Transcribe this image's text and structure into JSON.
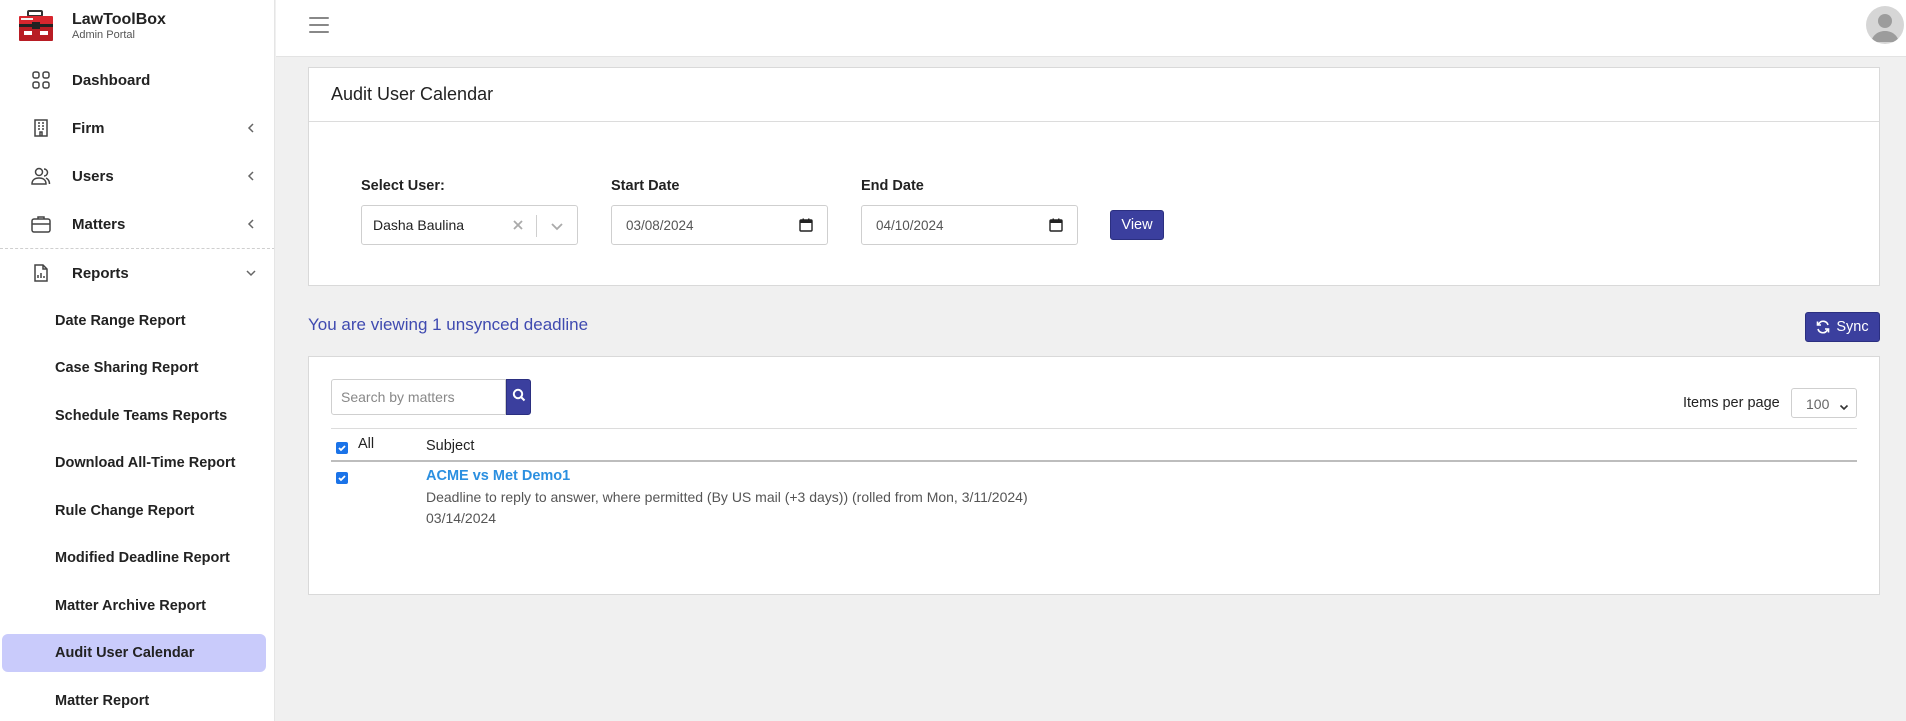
{
  "brand": {
    "name": "LawToolBox",
    "subtitle": "Admin Portal"
  },
  "sidebar": {
    "items": [
      {
        "label": "Dashboard",
        "icon": "grid-icon"
      },
      {
        "label": "Firm",
        "icon": "building-icon",
        "expandable": true
      },
      {
        "label": "Users",
        "icon": "users-icon",
        "expandable": true
      },
      {
        "label": "Matters",
        "icon": "briefcase-icon",
        "expandable": true
      },
      {
        "label": "Reports",
        "icon": "report-icon",
        "expanded": true
      }
    ],
    "reports": [
      {
        "label": "Date Range Report"
      },
      {
        "label": "Case Sharing Report"
      },
      {
        "label": "Schedule Teams Reports"
      },
      {
        "label": "Download All-Time Report"
      },
      {
        "label": "Rule Change Report"
      },
      {
        "label": "Modified Deadline Report"
      },
      {
        "label": "Matter Archive Report"
      },
      {
        "label": "Audit User Calendar",
        "active": true
      },
      {
        "label": "Matter Report"
      }
    ]
  },
  "page": {
    "title": "Audit User Calendar",
    "form": {
      "select_user_label": "Select User:",
      "selected_user": "Dasha Baulina",
      "start_date_label": "Start Date",
      "start_date": "03/08/2024",
      "end_date_label": "End Date",
      "end_date": "04/10/2024",
      "view_button": "View"
    },
    "viewing_text": "You are viewing 1 unsynced deadline",
    "sync_button": "Sync",
    "search": {
      "placeholder": "Search by matters"
    },
    "items_per_page_label": "Items per page",
    "items_per_page": "100",
    "table": {
      "col_all": "All",
      "col_subject": "Subject",
      "rows": [
        {
          "title": "ACME vs Met Demo1",
          "description": "Deadline to reply to answer, where permitted (By US mail (+3 days)) (rolled from Mon, 3/11/2024)",
          "date": "03/14/2024",
          "checked": true
        }
      ]
    }
  },
  "colors": {
    "accent": "#3b3f9e",
    "active_bg": "#c9cbfb",
    "link": "#2b8fe0",
    "viewing_text": "#3f4ab0"
  }
}
